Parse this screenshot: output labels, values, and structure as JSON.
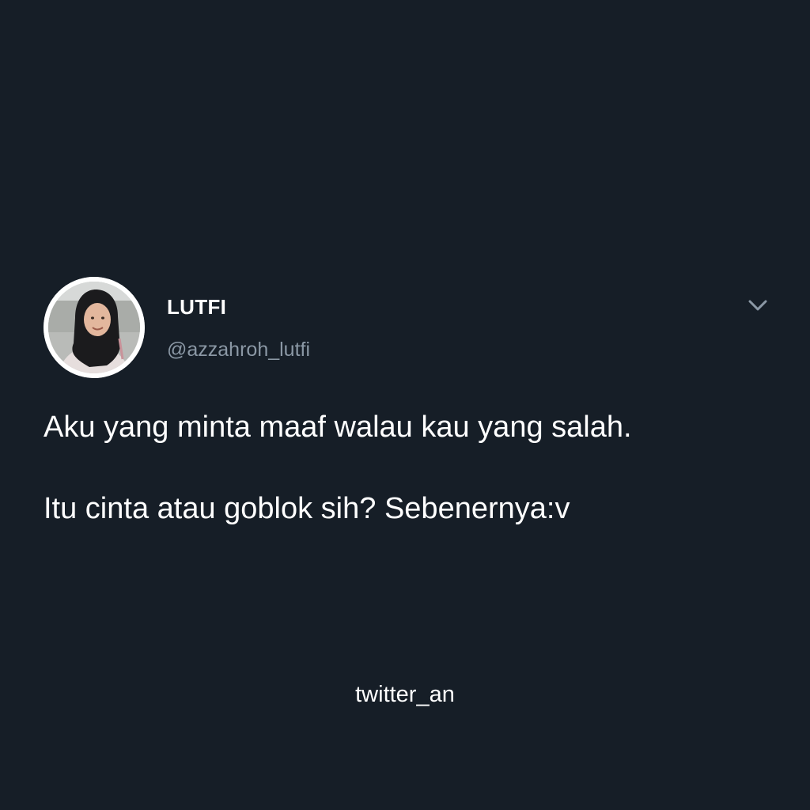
{
  "tweet": {
    "author": {
      "display_name": "LUTFI",
      "handle": "@azzahroh_lutfi",
      "avatar": "avatar-photo-hijab"
    },
    "menu_icon": "chevron-down-icon",
    "text_lines": [
      "Aku yang minta maaf walau kau yang salah.",
      "Itu cinta atau goblok sih? Sebenernya:v"
    ]
  },
  "watermark": "twitter_an",
  "colors": {
    "background": "#161e27",
    "text": "#ffffff",
    "secondary_text": "#8b98a5"
  }
}
